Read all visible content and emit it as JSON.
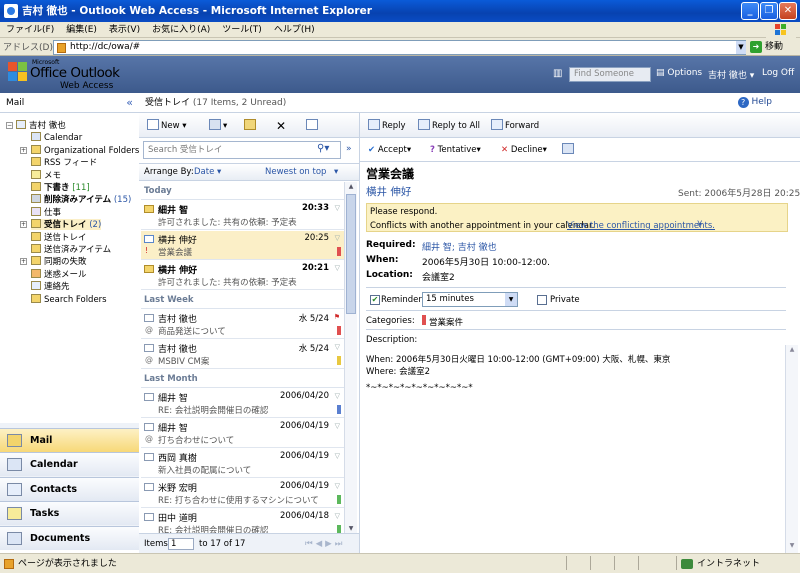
{
  "window": {
    "title": "吉村 徹也 - Outlook Web Access - Microsoft Internet Explorer"
  },
  "menu": [
    "ファイル(F)",
    "編集(E)",
    "表示(V)",
    "お気に入り(A)",
    "ツール(T)",
    "ヘルプ(H)"
  ],
  "address": {
    "label": "アドレス(D)",
    "url": "http://dc/owa/#",
    "go": "移動"
  },
  "header": {
    "brand_ms": "Microsoft",
    "brand_product": "Office Outlook",
    "brand_sub": "Web Access",
    "find_placeholder": "Find Someone",
    "options": "Options",
    "user": "吉村 徹也",
    "logoff": "Log Off",
    "help": "Help"
  },
  "nav": {
    "title": "Mail",
    "tree": [
      {
        "label": "吉村 徹也",
        "level": 0,
        "bold": false
      },
      {
        "label": "Calendar",
        "level": 1,
        "bold": false
      },
      {
        "label": "Organizational Folders",
        "level": 1,
        "bold": false
      },
      {
        "label": "RSS フィード",
        "level": 1,
        "bold": false
      },
      {
        "label": "メモ",
        "level": 1,
        "bold": false
      },
      {
        "label": "下書き",
        "level": 1,
        "bold": true,
        "count": "[11]"
      },
      {
        "label": "削除済みアイテム",
        "level": 1,
        "bold": true,
        "count": "(15)"
      },
      {
        "label": "仕事",
        "level": 1,
        "bold": false
      },
      {
        "label": "受信トレイ",
        "level": 1,
        "bold": true,
        "count": "(2)"
      },
      {
        "label": "送信トレイ",
        "level": 1,
        "bold": false
      },
      {
        "label": "送信済みアイテム",
        "level": 1,
        "bold": false
      },
      {
        "label": "同期の失敗",
        "level": 1,
        "bold": false
      },
      {
        "label": "迷惑メール",
        "level": 1,
        "bold": false
      },
      {
        "label": "連絡先",
        "level": 1,
        "bold": false
      },
      {
        "label": "Search Folders",
        "level": 1,
        "bold": false
      }
    ],
    "buttons": [
      "Mail",
      "Calendar",
      "Contacts",
      "Tasks",
      "Documents"
    ]
  },
  "list": {
    "folder": "受信トレイ",
    "summary": "(17 Items, 2 Unread)",
    "toolbar_new": "New",
    "search_placeholder": "Search 受信トレイ",
    "arrange_label": "Arrange By:",
    "arrange_value": "Date",
    "sort_value": "Newest on top",
    "groups": [
      {
        "name": "Today",
        "messages": [
          {
            "from": "細井 智",
            "date": "20:33",
            "subject": "許可されました: 共有の依頼: 予定表",
            "bold": true,
            "kind": "unread",
            "cat": ""
          },
          {
            "from": "横井 伸好",
            "date": "20:25",
            "subject": "営業会議",
            "bold": false,
            "kind": "cal",
            "cat": "#e05050",
            "selected": true,
            "mark": "!"
          },
          {
            "from": "横井 伸好",
            "date": "20:21",
            "subject": "許可されました: 共有の依頼: 予定表",
            "bold": true,
            "kind": "unread",
            "cat": ""
          }
        ]
      },
      {
        "name": "Last Week",
        "messages": [
          {
            "from": "吉村 徹也",
            "date": "水 5/24",
            "subject": "商品発送について",
            "bold": false,
            "kind": "read",
            "cat": "#e05050",
            "mark": "@",
            "flag": "red"
          },
          {
            "from": "吉村 徹也",
            "date": "水 5/24",
            "subject": "MSBIV CM案",
            "bold": false,
            "kind": "read",
            "cat": "#e8c840",
            "mark": "@"
          }
        ]
      },
      {
        "name": "Last Month",
        "messages": [
          {
            "from": "細井 智",
            "date": "2006/04/20",
            "subject": "RE: 会社説明会開催日の確認",
            "bold": false,
            "kind": "read",
            "cat": "#5a7fd0"
          },
          {
            "from": "細井 智",
            "date": "2006/04/19",
            "subject": "打ち合わせについて",
            "bold": false,
            "kind": "read",
            "cat": "",
            "mark": "@"
          },
          {
            "from": "西岡 真樹",
            "date": "2006/04/19",
            "subject": "新入社員の配属について",
            "bold": false,
            "kind": "read",
            "cat": ""
          },
          {
            "from": "米野 宏明",
            "date": "2006/04/19",
            "subject": "RE: 打ち合わせに使用するマシンについて",
            "bold": false,
            "kind": "read",
            "cat": "#5cb85c"
          },
          {
            "from": "田中 道明",
            "date": "2006/04/18",
            "subject": "RE: 会社説明会開催日の確認",
            "bold": false,
            "kind": "read",
            "cat": "#5cb85c"
          }
        ]
      }
    ],
    "footer_items": "Items",
    "footer_page": "1",
    "footer_range": "to 17 of 17"
  },
  "reading": {
    "reply": "Reply",
    "reply_all": "Reply to All",
    "forward": "Forward",
    "accept": "Accept",
    "tentative": "Tentative",
    "decline": "Decline",
    "subject": "営業会議",
    "from": "横井 伸好",
    "sent": "Sent:  2006年5月28日 20:25",
    "respond": "Please respond.",
    "conflict": "Conflicts with another appointment in your calendar.",
    "conflict_link": "View the conflicting appointments.",
    "required_label": "Required:",
    "required_value": "細井 智; 吉村 徹也",
    "when_label": "When:",
    "when_value": "2006年5月30日 10:00-12:00.",
    "location_label": "Location:",
    "location_value": "会議室2",
    "reminder_label": "Reminder:",
    "reminder_value": "15 minutes",
    "private_label": "Private",
    "categories_label": "Categories:",
    "categories_value": "営業案件",
    "description_label": "Description:",
    "desc_when": "When: 2006年5月30日火曜日 10:00-12:00 (GMT+09:00) 大阪、札幌、東京",
    "desc_where": "Where: 会議室2",
    "desc_sep": "*~*~*~*~*~*~*~*~*~*"
  },
  "status": {
    "left": "ページが表示されました",
    "zone": "イントラネット"
  }
}
